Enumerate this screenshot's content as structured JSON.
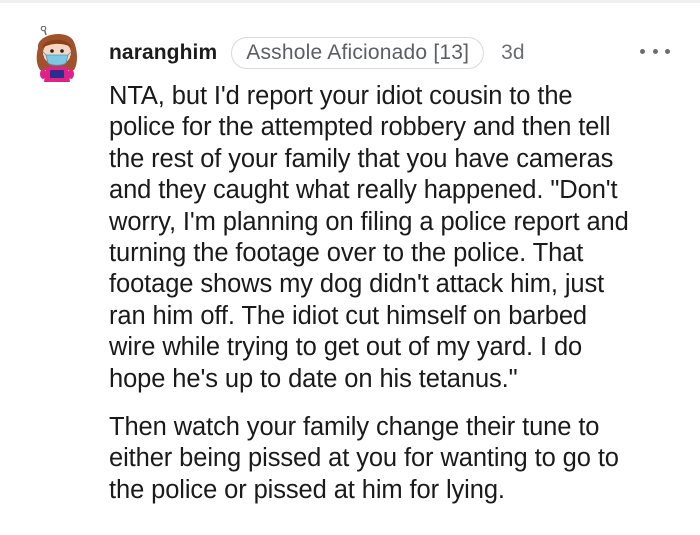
{
  "comment": {
    "username": "naranghim",
    "flair": "Asshole Aficionado [13]",
    "timestamp": "3d",
    "paragraphs": [
      {
        "lines": [
          "NTA, but I'd report your idiot cousin to the",
          "police for the attempted robbery and then tell",
          "the rest of your family that you have cameras",
          "and they caught what really happened. \"Don't",
          "worry, I'm planning on filing a police report and",
          "turning the footage over to the police. That",
          "footage shows my dog didn't attack him, just",
          "ran him off. The idiot cut himself on barbed",
          "wire while trying to get out of my yard. I do",
          "hope he's up to date on his tetanus.\""
        ]
      },
      {
        "lines": [
          "Then watch your family change their tune to",
          "either being pissed at you for wanting to go to",
          "the police or pissed at him for lying."
        ]
      }
    ]
  },
  "colors": {
    "username": "#1c1c1c",
    "flair_border": "#d8dadc",
    "meta_text": "#6b6e72",
    "body_text": "#1a1a1b",
    "avatar_hair": "#a0522d",
    "avatar_shirt": "#e0218a",
    "avatar_mask": "#7ec8e3"
  },
  "icons": {
    "avatar": "snoo-avatar-icon",
    "more": "more-options-icon"
  }
}
